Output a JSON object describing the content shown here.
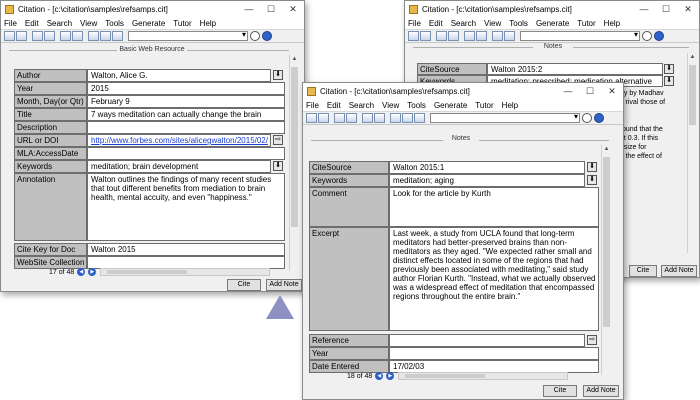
{
  "window_back": {
    "title": "Citation - [c:\\citation\\samples\\refsamps.cit]",
    "menu": [
      "File",
      "Edit",
      "Search",
      "View",
      "Tools",
      "Generate",
      "Tutor",
      "Help"
    ],
    "section_title": "Notes",
    "fields": [
      {
        "label": "CiteSource",
        "value": "Walton 2015:2"
      },
      {
        "label": "Keywords",
        "value": "meditation; prescribed; medication alternative"
      }
    ],
    "partial_texts": [
      "dy by Madhav",
      "s rival those of",
      "found that the",
      "at 0.3. If this",
      "t size for",
      "s the effect of"
    ],
    "buttons": {
      "cite": "Cite",
      "add_note": "Add Note"
    }
  },
  "window_left": {
    "title": "Citation - [c:\\citation\\samples\\refsamps.cit]",
    "menu": [
      "File",
      "Edit",
      "Search",
      "View",
      "Tools",
      "Generate",
      "Tutor",
      "Help"
    ],
    "section_title": "Basic Web Resource",
    "fields": {
      "author": {
        "label": "Author",
        "value": "Walton, Alice G."
      },
      "year": {
        "label": "Year",
        "value": "2015"
      },
      "month_day": {
        "label": "Month, Day(or Qtr)",
        "value": "February 9"
      },
      "title": {
        "label": "Title",
        "value": "7 ways meditation can actually change the brain"
      },
      "description": {
        "label": "Description",
        "value": ""
      },
      "url": {
        "label": "URL or DOI",
        "value": "http://www.forbes.com/sites/alicegwalton/2015/02/"
      },
      "mla_access": {
        "label": "MLA:AccessDate",
        "value": ""
      },
      "keywords": {
        "label": "Keywords",
        "value": "meditation; brain development"
      },
      "annotation": {
        "label": "Annotation",
        "value": "Walton outlines the findings of many recent studies that tout different benefits from mediation to brain health, mental accuity, and even \"happiness.\""
      },
      "cite_key": {
        "label": "Cite Key for Doc",
        "value": "Walton 2015"
      },
      "website_collection": {
        "label": "WebSite Collection",
        "value": ""
      }
    },
    "record_counter": "17 of 48",
    "buttons": {
      "cite": "Cite",
      "add_note": "Add Note"
    }
  },
  "window_front": {
    "title": "Citation - [c:\\citation\\samples\\refsamps.cit]",
    "menu": [
      "File",
      "Edit",
      "Search",
      "View",
      "Tools",
      "Generate",
      "Tutor",
      "Help"
    ],
    "section_title": "Notes",
    "fields": {
      "cite_source": {
        "label": "CiteSource",
        "value": "Walton 2015:1"
      },
      "keywords": {
        "label": "Keywords",
        "value": "meditation; aging"
      },
      "comment": {
        "label": "Comment",
        "value": "Look for the article by Kurth"
      },
      "excerpt": {
        "label": "Excerpt",
        "value": "Last week, a study from UCLA found that long-term meditators had better-preserved brains than non-meditators as they aged. \"We expected rather small and distinct effects located in some of the regions that had previously been associated with meditating,\" said study author Florian Kurth. \"Instead, what we actually observed was a widespread effect of meditation that encompassed regions throughout the entire brain.\""
      },
      "reference": {
        "label": "Reference",
        "value": ""
      },
      "year": {
        "label": "Year",
        "value": ""
      },
      "date_entered": {
        "label": "Date Entered",
        "value": "17/02/03"
      }
    },
    "record_counter": "18 of 48",
    "buttons": {
      "cite": "Cite",
      "add_note": "Add Note"
    }
  },
  "window_controls": {
    "minimize": "—",
    "maximize": "☐",
    "close": "✕"
  },
  "icons": {
    "dropdown": "▾",
    "field_dropdown": "⬇",
    "link_button": "⇨",
    "nav_prev": "◀",
    "nav_next": "▶"
  },
  "colors": {
    "label_bg": "#c0c0c0",
    "link": "#1a3fd0",
    "nav_dot": "#2a5fc7",
    "pointer_arrow": "#8e90c4"
  }
}
